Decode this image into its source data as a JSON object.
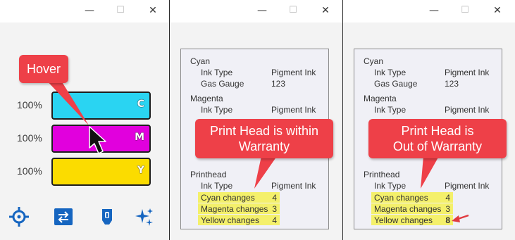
{
  "windows": [
    {
      "controls": {
        "minimize": "—",
        "maximize": "☐",
        "close": "✕"
      }
    },
    {
      "controls": {
        "minimize": "—",
        "maximize": "☐",
        "close": "✕"
      }
    },
    {
      "controls": {
        "minimize": "—",
        "maximize": "☐",
        "close": "✕"
      }
    }
  ],
  "ink_window": {
    "callout": "Hover",
    "levels": [
      {
        "percent": "100%",
        "letter": "C",
        "color": "#2ad4f2"
      },
      {
        "percent": "100%",
        "letter": "M",
        "color": "#e100dd"
      },
      {
        "percent": "100%",
        "letter": "Y",
        "color": "#fbdc00"
      }
    ],
    "icons": [
      "crosshair-icon",
      "swap-icon",
      "cartridge-icon",
      "sparkle-icon"
    ],
    "accent": "#1565c0"
  },
  "panel_within": {
    "cyan": {
      "title": "Cyan",
      "ink_type_label": "Ink Type",
      "ink_type_value": "Pigment Ink",
      "gauge_label": "Gas Gauge",
      "gauge_value": "123"
    },
    "magenta": {
      "title": "Magenta",
      "ink_type_label": "Ink Type",
      "ink_type_value": "Pigment Ink"
    },
    "printhead": {
      "title": "Printhead",
      "ink_type_label": "Ink Type",
      "ink_type_value": "Pigment Ink"
    },
    "changes": [
      {
        "label": "Cyan changes",
        "value": "4"
      },
      {
        "label": "Magenta changes",
        "value": "3"
      },
      {
        "label": "Yellow changes",
        "value": "4"
      }
    ],
    "callout": [
      "Print Head is within",
      "Warranty"
    ]
  },
  "panel_out": {
    "cyan": {
      "title": "Cyan",
      "ink_type_label": "Ink Type",
      "ink_type_value": "Pigment Ink",
      "gauge_label": "Gas Gauge",
      "gauge_value": "123"
    },
    "magenta": {
      "title": "Magenta",
      "ink_type_label": "Ink Type",
      "ink_type_value": "Pigment Ink"
    },
    "printhead": {
      "title": "Printhead",
      "ink_type_label": "Ink Type",
      "ink_type_value": "Pigment Ink"
    },
    "changes": [
      {
        "label": "Cyan changes",
        "value": "4"
      },
      {
        "label": "Magenta changes",
        "value": "3"
      },
      {
        "label": "Yellow changes",
        "value": "8"
      }
    ],
    "callout": [
      "Print Head is",
      "Out of Warranty"
    ]
  }
}
